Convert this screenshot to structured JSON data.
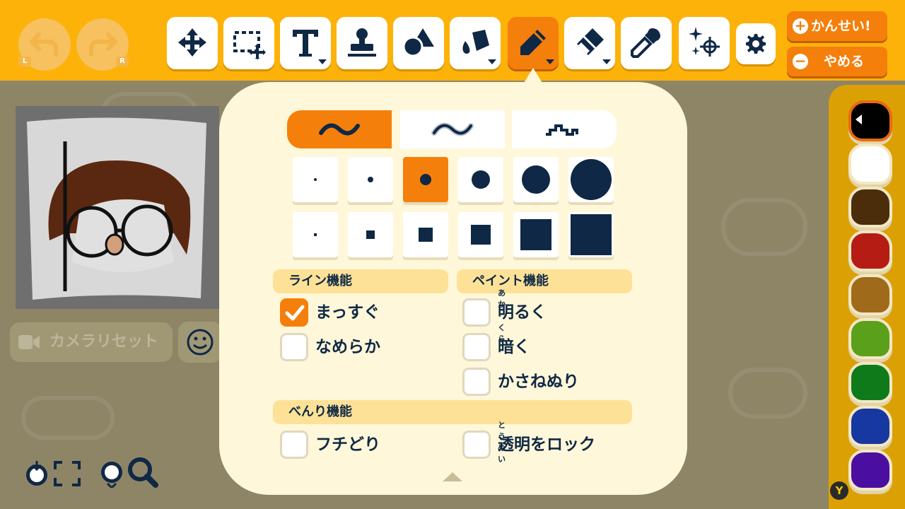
{
  "toolbar": {
    "undo_hint": "L",
    "redo_hint": "R",
    "tools": [
      {
        "name": "move-tool-button",
        "icon": "move-arrows-icon"
      },
      {
        "name": "select-tool-button",
        "icon": "selection-icon"
      },
      {
        "name": "text-tool-button",
        "icon": "text-T-icon"
      },
      {
        "name": "stamp-tool-button",
        "icon": "stamp-icon"
      },
      {
        "name": "shape-tool-button",
        "icon": "shapes-icon"
      },
      {
        "name": "fill-tool-button",
        "icon": "paint-bucket-icon"
      },
      {
        "name": "pen-tool-button",
        "icon": "pencil-icon",
        "active": true
      },
      {
        "name": "eraser-tool-button",
        "icon": "eraser-icon"
      },
      {
        "name": "eyedropper-tool-button",
        "icon": "eyedropper-icon"
      },
      {
        "name": "effects-tool-button",
        "icon": "sparkle-icon"
      }
    ],
    "complete_label": "かんせい!",
    "quit_label": "やめる",
    "complete_glyph": "+",
    "quit_glyph": "−"
  },
  "left": {
    "camera_reset_label": "カメラリセット",
    "face_glyph": "☺"
  },
  "pen_panel": {
    "line_types": [
      "smooth",
      "soft",
      "pixel"
    ],
    "selected_line_type": "smooth",
    "brush_rows": [
      {
        "shape": "round",
        "selected_index": 2
      },
      {
        "shape": "square",
        "selected_index": -1
      }
    ],
    "line_header": "ライン機能",
    "paint_header": "ペイント機能",
    "util_header": "べんり機能",
    "options": {
      "straight": {
        "label": "まっすぐ",
        "checked": true
      },
      "smooth": {
        "label": "なめらか",
        "checked": false
      },
      "brighten": {
        "label": "明るく",
        "ruby": "あか",
        "checked": false
      },
      "darken": {
        "label": "暗く",
        "ruby": "くら",
        "checked": false
      },
      "overpaint": {
        "label": "かさねぬり",
        "checked": false
      },
      "outline": {
        "label": "フチどり",
        "checked": false
      },
      "lock_transparency": {
        "label": "透明をロック",
        "ruby": "とうめい",
        "checked": false
      }
    }
  },
  "palette": {
    "colors": [
      "#000000",
      "#ffffff",
      "#4b2d0c",
      "#b51c14",
      "#a06a1b",
      "#5aa01a",
      "#0f7a1a",
      "#1638a0",
      "#4a0fa0"
    ],
    "selected_index": 0,
    "y_hint": "Y"
  },
  "accent_color": "#f57f0b",
  "toolbar_color": "#fdb20a"
}
